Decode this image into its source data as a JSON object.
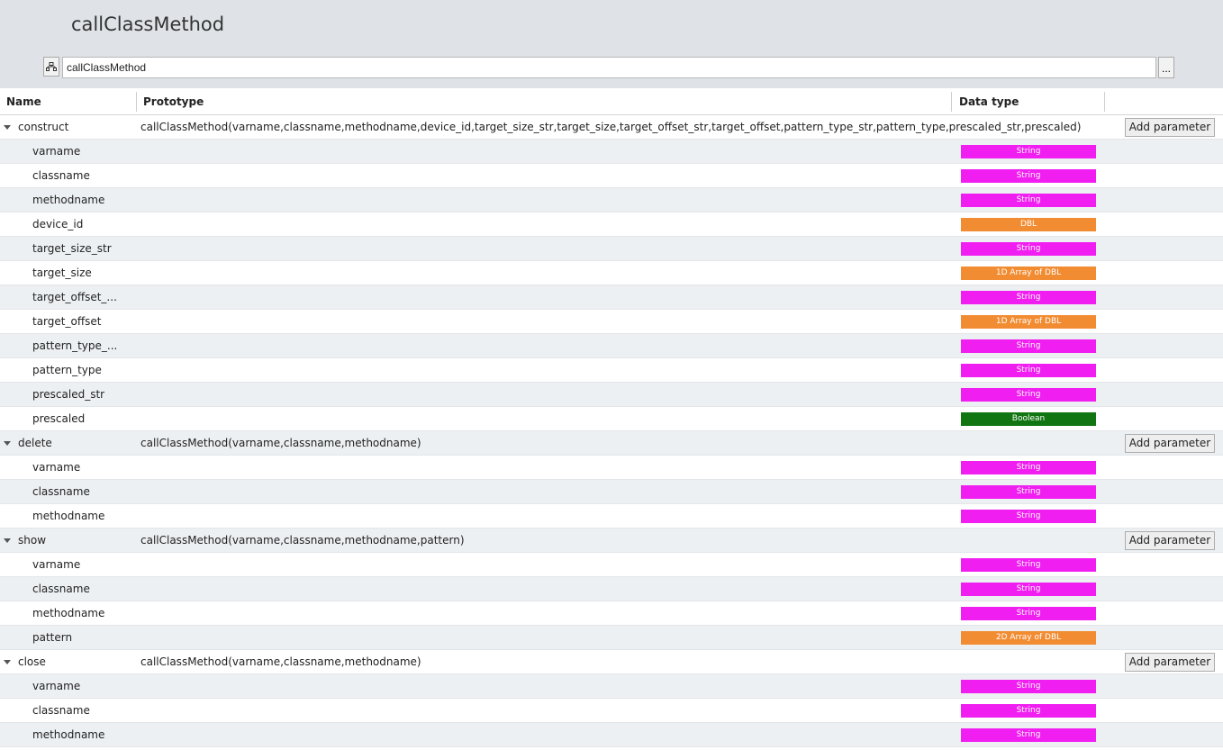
{
  "title": "callClassMethod",
  "path_field": {
    "value": "callClassMethod",
    "browse_label": "..."
  },
  "columns": {
    "name": "Name",
    "prototype": "Prototype",
    "data_type": "Data type"
  },
  "add_parameter_label": "Add parameter",
  "type_colors": {
    "String": "#f01ef0",
    "DBL": "#f28c32",
    "1D Array of DBL": "#f28c32",
    "2D Array of DBL": "#f28c32",
    "Boolean": "#117511"
  },
  "methods": [
    {
      "name": "construct",
      "prototype": "callClassMethod(varname,classname,methodname,device_id,target_size_str,target_size,target_offset_str,target_offset,pattern_type_str,pattern_type,prescaled_str,prescaled)",
      "params": [
        {
          "name": "varname",
          "type": "String"
        },
        {
          "name": "classname",
          "type": "String"
        },
        {
          "name": "methodname",
          "type": "String"
        },
        {
          "name": "device_id",
          "type": "DBL"
        },
        {
          "name": "target_size_str",
          "type": "String"
        },
        {
          "name": "target_size",
          "type": "1D Array of DBL"
        },
        {
          "name": "target_offset_...",
          "type": "String"
        },
        {
          "name": "target_offset",
          "type": "1D Array of DBL"
        },
        {
          "name": "pattern_type_...",
          "type": "String"
        },
        {
          "name": "pattern_type",
          "type": "String"
        },
        {
          "name": "prescaled_str",
          "type": "String"
        },
        {
          "name": "prescaled",
          "type": "Boolean"
        }
      ]
    },
    {
      "name": "delete",
      "prototype": "callClassMethod(varname,classname,methodname)",
      "params": [
        {
          "name": "varname",
          "type": "String"
        },
        {
          "name": "classname",
          "type": "String"
        },
        {
          "name": "methodname",
          "type": "String"
        }
      ]
    },
    {
      "name": "show",
      "prototype": "callClassMethod(varname,classname,methodname,pattern)",
      "params": [
        {
          "name": "varname",
          "type": "String"
        },
        {
          "name": "classname",
          "type": "String"
        },
        {
          "name": "methodname",
          "type": "String"
        },
        {
          "name": "pattern",
          "type": "2D Array of DBL"
        }
      ]
    },
    {
      "name": "close",
      "prototype": "callClassMethod(varname,classname,methodname)",
      "params": [
        {
          "name": "varname",
          "type": "String"
        },
        {
          "name": "classname",
          "type": "String"
        },
        {
          "name": "methodname",
          "type": "String"
        }
      ]
    }
  ]
}
